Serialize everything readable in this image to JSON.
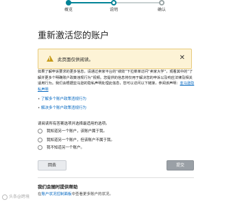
{
  "stepper": {
    "steps": [
      "概览",
      "说明",
      "确认"
    ],
    "active_index": 1
  },
  "page": {
    "title": "重新激活您的账户"
  },
  "alert": {
    "text": "此页面仅供阅读。",
    "close_symbol": "✕"
  },
  "paragraph": {
    "text": "如果了解申诉要求的更多信息，请通过卖家平台的“绩效”下拉菜单访问“卖家大学”，观看其中的“了解并更多个明确账户政策违规行为”视频。您提供的信息将仅用于解决您的申诉以及响应法律及相关适用行为。我们会根据亚马逊的隐私声明处理此信息，您可以访问以下链接，参阅该声明：",
    "link": "亚马逊隐私声明"
  },
  "links": [
    "了解多个账户政策违规行为",
    "解决多个账户政策违规行为"
  ],
  "question": "请阅读所有答案选项并选择最适用的选项。",
  "options": [
    "我知道另一个账户，该账户属于我。",
    "我知道另一个账户，但该账户不属于我。",
    "我不知道另一个账户。"
  ],
  "buttons": {
    "back": "回去",
    "submit": "提交"
  },
  "help": {
    "title": "我们会随时提供帮助",
    "text_prefix": "在",
    "link": "账户状况控制面板",
    "text_suffix": "中查看更多账户的状况。"
  },
  "watermark": "头条@跨境",
  "colors": {
    "accent": "#008296",
    "link": "#0066c0",
    "alert_bg": "#fdf3d6",
    "warning": "#c79b19"
  },
  "icons": {
    "alert": "warning-triangle-icon",
    "close": "close-icon"
  }
}
